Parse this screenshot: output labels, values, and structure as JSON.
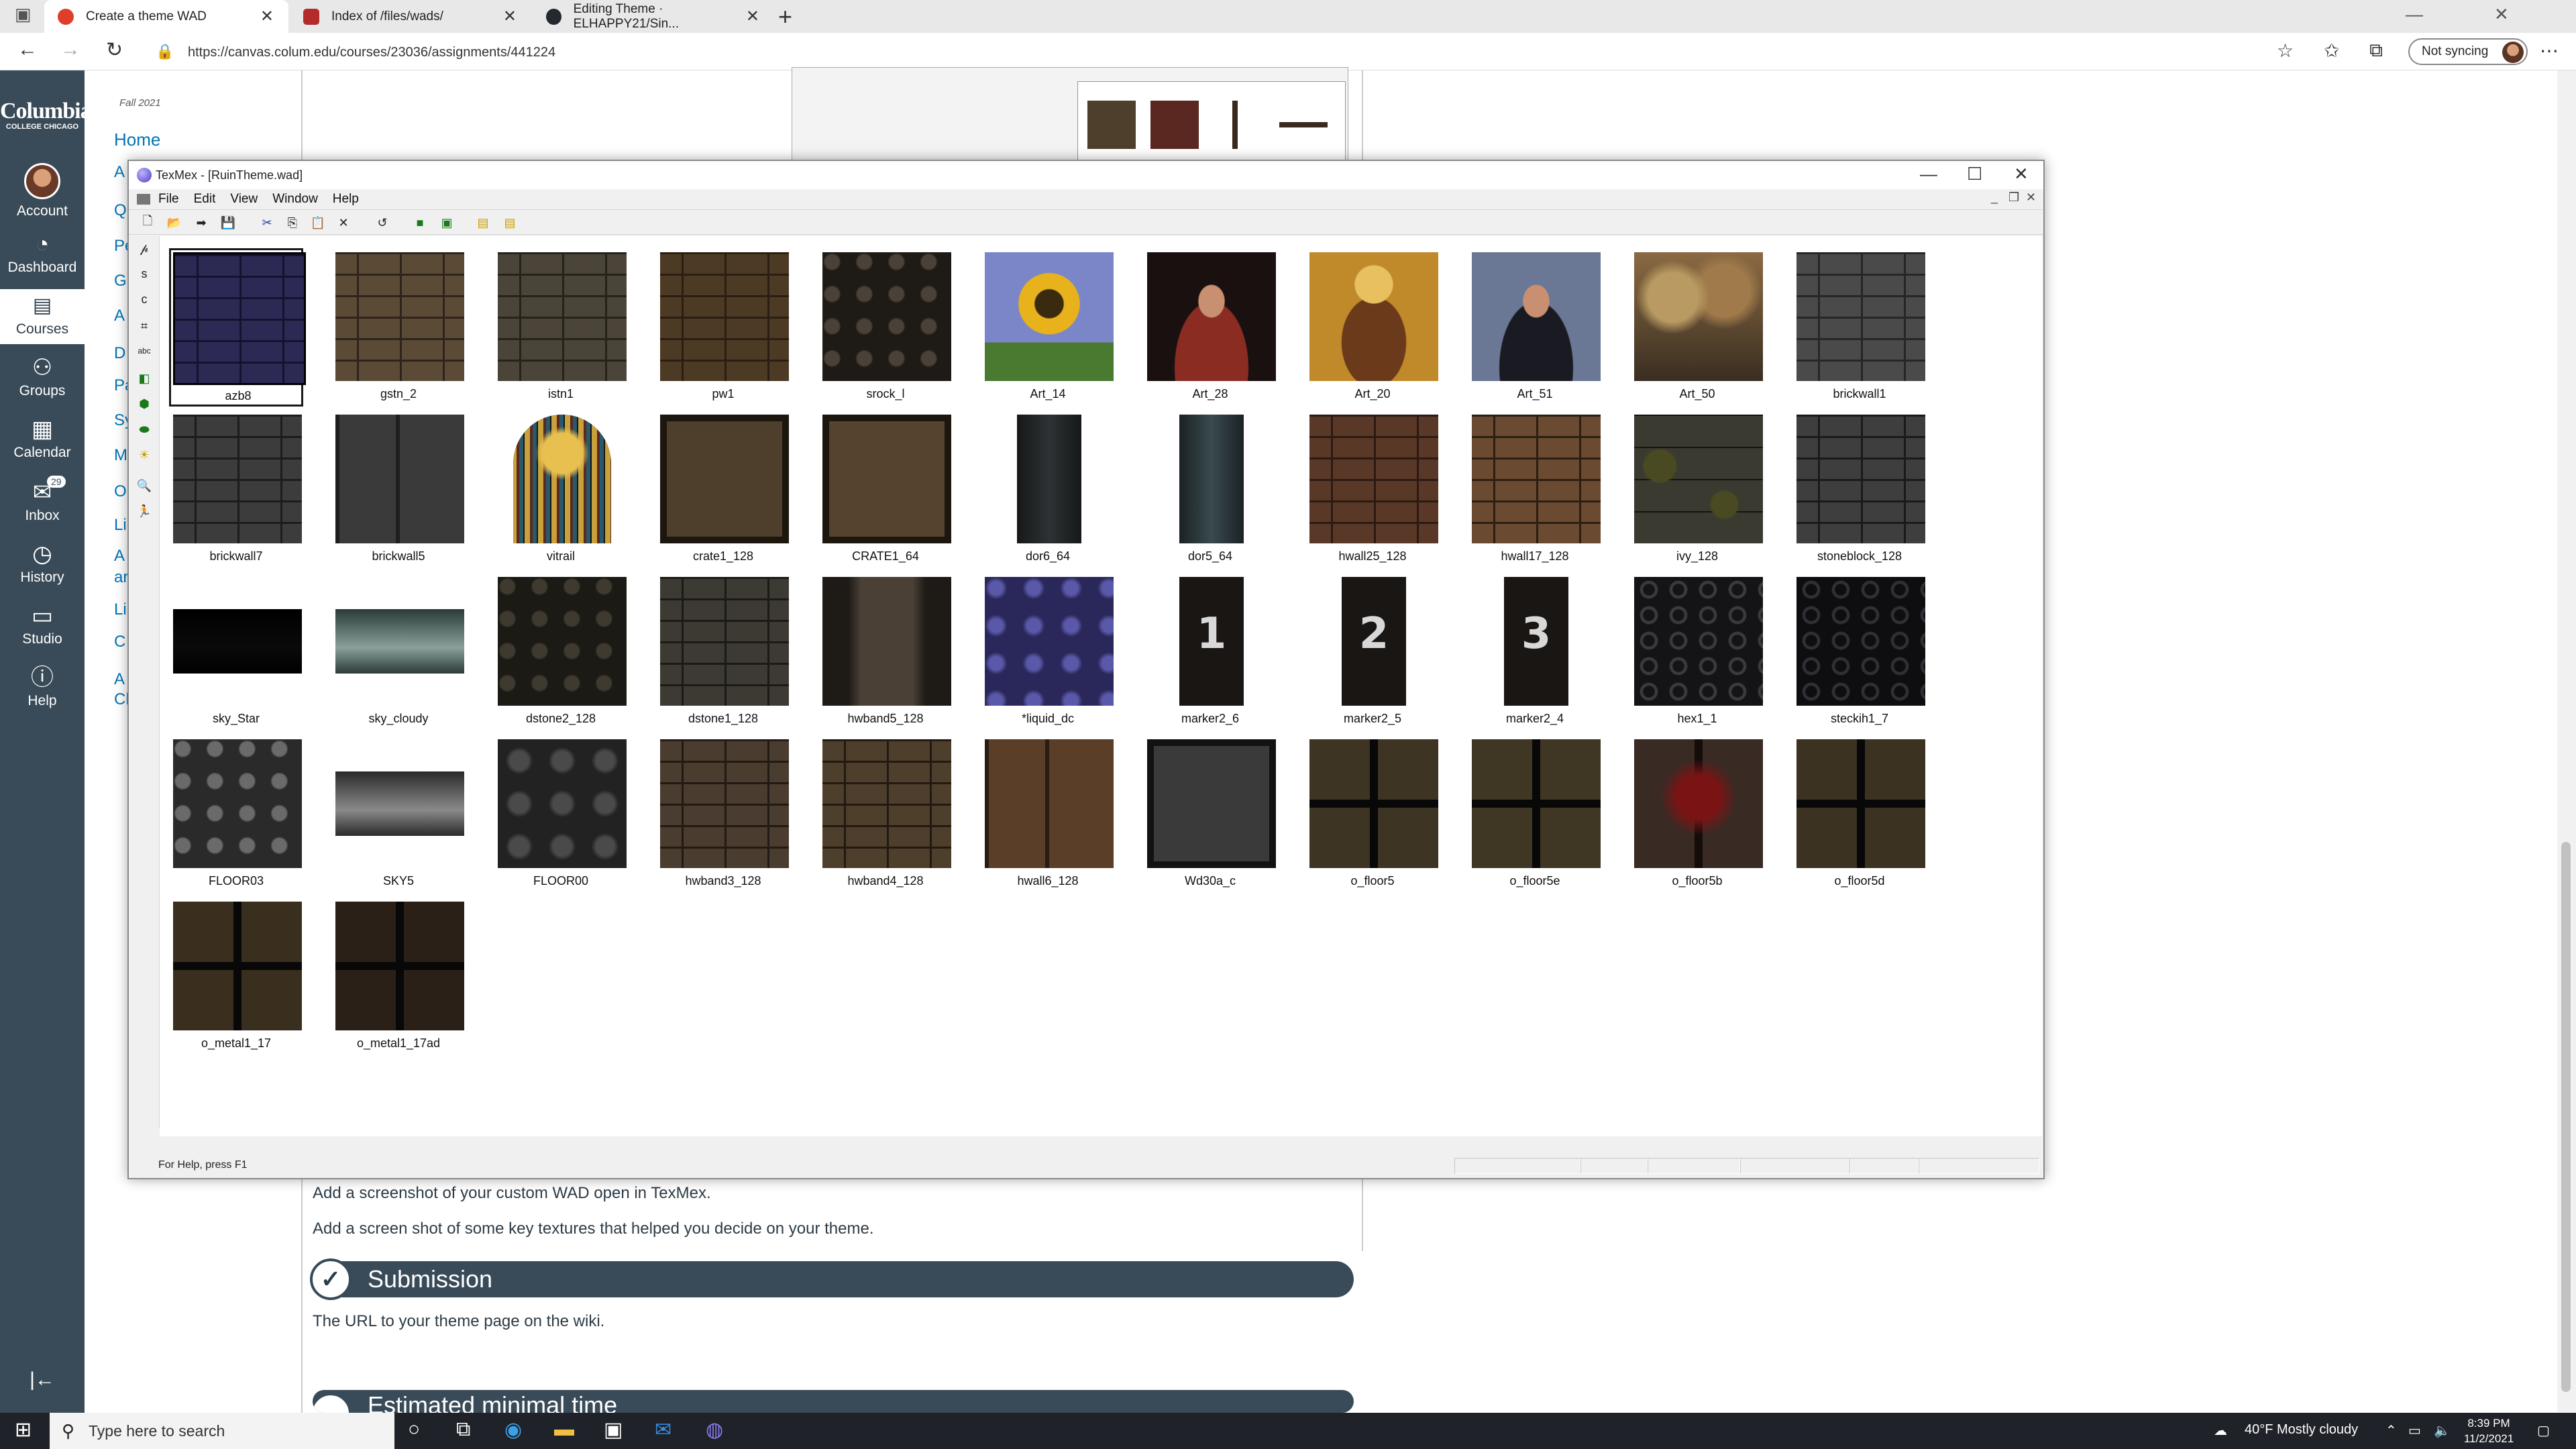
{
  "browser": {
    "tabs": [
      {
        "label": "Create a theme WAD",
        "active": true,
        "favicon_color": "#e03e2d"
      },
      {
        "label": "Index of /files/wads/",
        "active": false,
        "favicon_color": "#b52b2b"
      },
      {
        "label": "Editing Theme · ELHAPPY21/Sin...",
        "active": false,
        "favicon_color": "#24292f"
      }
    ],
    "url": "https://canvas.colum.edu/courses/23036/assignments/441224",
    "sync_label": "Not syncing"
  },
  "canvas_nav": {
    "logo": "Columbia",
    "logo_sub": "COLLEGE CHICAGO",
    "items": [
      {
        "label": "Account",
        "icon": "avatar"
      },
      {
        "label": "Dashboard",
        "icon": "dashboard-icon"
      },
      {
        "label": "Courses",
        "icon": "courses-icon"
      },
      {
        "label": "Groups",
        "icon": "groups-icon"
      },
      {
        "label": "Calendar",
        "icon": "calendar-icon"
      },
      {
        "label": "Inbox",
        "icon": "inbox-icon",
        "badge": "29"
      },
      {
        "label": "History",
        "icon": "history-icon"
      },
      {
        "label": "Studio",
        "icon": "studio-icon"
      },
      {
        "label": "Help",
        "icon": "help-icon"
      }
    ],
    "collapse_label": "|←"
  },
  "course_nav": {
    "term": "Fall 2021",
    "home": "Home",
    "links": [
      "A",
      "Q",
      "Pe",
      "G",
      "A",
      "D",
      "Pa",
      "Sy",
      "M",
      "O",
      "Li",
      "A",
      "ar",
      "Li",
      "C",
      "A",
      "Cl"
    ]
  },
  "page": {
    "para1": "Add a screenshot of your custom WAD open in TexMex.",
    "para2": "Add a screen shot of some key textures that helped you decide on your theme.",
    "submission_title": "Submission",
    "submission_text": "The URL to your theme page on the wiki.",
    "estimated_title": "Estimated minimal time"
  },
  "texmex": {
    "title": "TexMex - [RuinTheme.wad]",
    "menu": [
      "File",
      "Edit",
      "View",
      "Window",
      "Help"
    ],
    "status": "For Help, press F1",
    "textures": [
      {
        "name": "azb8",
        "kind": "bricks",
        "c1": "#2c2a55",
        "c2": "#14122e",
        "selected": true
      },
      {
        "name": "gstn_2",
        "kind": "bricks",
        "c1": "#5b4a36",
        "c2": "#2e241a"
      },
      {
        "name": "istn1",
        "kind": "bricks",
        "c1": "#4a4538",
        "c2": "#26231c"
      },
      {
        "name": "pw1",
        "kind": "bricks",
        "c1": "#4d3a24",
        "c2": "#2a1e12"
      },
      {
        "name": "srock_l",
        "kind": "cobble",
        "c1": "#4a4238",
        "c2": "#1e1a15"
      },
      {
        "name": "Art_14",
        "kind": "sunflower",
        "c1": "#7b86c8",
        "c2": "#e8b21c"
      },
      {
        "name": "Art_28",
        "kind": "portrait",
        "c1": "#1a1010",
        "c2": "#8a2c22"
      },
      {
        "name": "Art_20",
        "kind": "icon",
        "c1": "#c08a2a",
        "c2": "#6a3a1a"
      },
      {
        "name": "Art_51",
        "kind": "portrait",
        "c1": "#6a7896",
        "c2": "#1a1a22"
      },
      {
        "name": "Art_50",
        "kind": "forest",
        "c1": "#8a6a42",
        "c2": "#3a2e22"
      },
      {
        "name": "brickwall1",
        "kind": "bricks",
        "c1": "#4a4a4a",
        "c2": "#262626"
      },
      {
        "name": "brickwall7",
        "kind": "bricks",
        "c1": "#3c3c3c",
        "c2": "#1c1c1c"
      },
      {
        "name": "brickwall5",
        "kind": "panels",
        "c1": "#3a3a3a",
        "c2": "#1e1e1e"
      },
      {
        "name": "vitrail",
        "kind": "window",
        "c1": "#c8a03c",
        "c2": "#141414"
      },
      {
        "name": "crate1_128",
        "kind": "crate",
        "c1": "#4e3e2c",
        "c2": "#1c160f"
      },
      {
        "name": "CRATE1_64",
        "kind": "crate",
        "c1": "#56432e",
        "c2": "#1c160f"
      },
      {
        "name": "dor6_64",
        "kind": "door",
        "c1": "#2e3234",
        "c2": "#161819",
        "w": 0.5
      },
      {
        "name": "dor5_64",
        "kind": "door",
        "c1": "#3a4a4e",
        "c2": "#1a2224",
        "w": 0.5
      },
      {
        "name": "hwall25_128",
        "kind": "bricks",
        "c1": "#5a3828",
        "c2": "#2c1a12"
      },
      {
        "name": "hwall17_128",
        "kind": "bricks",
        "c1": "#6a4a30",
        "c2": "#2c1e12"
      },
      {
        "name": "ivy_128",
        "kind": "ivy",
        "c1": "#3a3a30",
        "c2": "#141410"
      },
      {
        "name": "stoneblock_128",
        "kind": "bricks",
        "c1": "#3e3e3e",
        "c2": "#1a1a1a"
      },
      {
        "name": "sky_Star",
        "kind": "sky",
        "c1": "#0a0a0a",
        "c2": "#000000",
        "h": 0.5
      },
      {
        "name": "sky_cloudy",
        "kind": "sky",
        "c1": "#8aa09a",
        "c2": "#2a3a38",
        "h": 0.5
      },
      {
        "name": "dstone2_128",
        "kind": "cobble",
        "c1": "#3e3a30",
        "c2": "#1c1a14"
      },
      {
        "name": "dstone1_128",
        "kind": "bricks",
        "c1": "#3c3a32",
        "c2": "#1c1a16"
      },
      {
        "name": "hwband5_128",
        "kind": "column",
        "c1": "#4a4036",
        "c2": "#1e1a16"
      },
      {
        "name": "*liquid_dc",
        "kind": "liquid",
        "c1": "#5a58a8",
        "c2": "#2a285a"
      },
      {
        "name": "marker2_6",
        "kind": "marker",
        "c1": "#3a3430",
        "c2": "#1a1614",
        "glyph": "1",
        "w": 0.5
      },
      {
        "name": "marker2_5",
        "kind": "marker",
        "c1": "#3a3430",
        "c2": "#1a1614",
        "glyph": "2",
        "w": 0.5
      },
      {
        "name": "marker2_4",
        "kind": "marker",
        "c1": "#3a3430",
        "c2": "#1a1614",
        "glyph": "3",
        "w": 0.5
      },
      {
        "name": "hex1_1",
        "kind": "hex",
        "c1": "#3a3a3e",
        "c2": "#141416"
      },
      {
        "name": "steckih1_7",
        "kind": "hex",
        "c1": "#2e3034",
        "c2": "#0e0e10"
      },
      {
        "name": "FLOOR03",
        "kind": "cobble",
        "c1": "#6a6a6a",
        "c2": "#2a2a2a"
      },
      {
        "name": "SKY5",
        "kind": "sky",
        "c1": "#8a8a8a",
        "c2": "#2a2a2a",
        "h": 0.5
      },
      {
        "name": "FLOOR00",
        "kind": "tiles",
        "c1": "#4a4a4a",
        "c2": "#222222"
      },
      {
        "name": "hwband3_128",
        "kind": "bricks",
        "c1": "#4a3c2e",
        "c2": "#221a14"
      },
      {
        "name": "hwband4_128",
        "kind": "bricks",
        "c1": "#4e3e2c",
        "c2": "#221a12"
      },
      {
        "name": "hwall6_128",
        "kind": "panels",
        "c1": "#5a3e28",
        "c2": "#2a1c12"
      },
      {
        "name": "Wd30a_c",
        "kind": "crate",
        "c1": "#3a3a3a",
        "c2": "#121212"
      },
      {
        "name": "o_floor5",
        "kind": "grate",
        "c1": "#3e3424",
        "c2": "#18140e"
      },
      {
        "name": "o_floor5e",
        "kind": "grate",
        "c1": "#403624",
        "c2": "#18140e"
      },
      {
        "name": "o_floor5b",
        "kind": "blood",
        "c1": "#3a2a24",
        "c2": "#7a1414"
      },
      {
        "name": "o_floor5d",
        "kind": "grate",
        "c1": "#3c3222",
        "c2": "#16120c"
      },
      {
        "name": "o_metal1_17",
        "kind": "grate",
        "c1": "#3a2e1e",
        "c2": "#100c08"
      },
      {
        "name": "o_metal1_17ad",
        "kind": "grate",
        "c1": "#2a2018",
        "c2": "#0e0a08"
      }
    ]
  },
  "taskbar": {
    "search_placeholder": "Type here to search",
    "weather": "40°F  Mostly cloudy",
    "time": "8:39 PM",
    "date": "11/2/2021"
  }
}
